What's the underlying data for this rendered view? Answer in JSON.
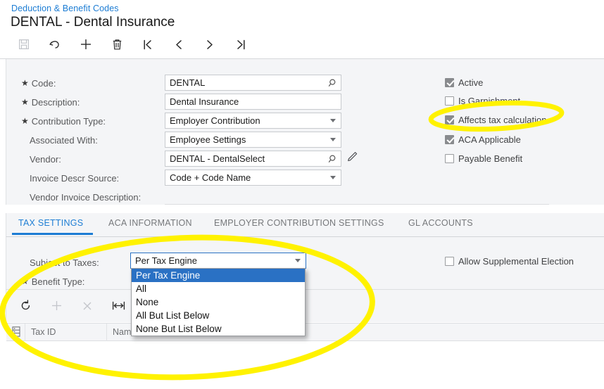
{
  "header": {
    "breadcrumb": "Deduction & Benefit Codes",
    "title": "DENTAL - Dental Insurance",
    "toolbar": [
      {
        "name": "save-button",
        "icon": "save-icon",
        "disabled": true
      },
      {
        "name": "undo-button",
        "icon": "undo-icon",
        "disabled": false
      },
      {
        "name": "add-button",
        "icon": "plus-icon",
        "disabled": false
      },
      {
        "name": "delete-button",
        "icon": "trash-icon",
        "disabled": false
      },
      {
        "name": "first-record-button",
        "icon": "first-icon",
        "disabled": false
      },
      {
        "name": "previous-record-button",
        "icon": "chevron-left-icon",
        "disabled": false
      },
      {
        "name": "next-record-button",
        "icon": "chevron-right-icon",
        "disabled": false
      },
      {
        "name": "last-record-button",
        "icon": "last-icon",
        "disabled": false
      }
    ]
  },
  "form": {
    "fields": [
      {
        "label": "Code:",
        "required": true,
        "value": "DENTAL",
        "control": "lookup"
      },
      {
        "label": "Description:",
        "required": true,
        "value": "Dental Insurance",
        "control": "text"
      },
      {
        "label": "Contribution Type:",
        "required": true,
        "value": "Employer Contribution",
        "control": "select"
      },
      {
        "label": "Associated With:",
        "required": false,
        "value": "Employee Settings",
        "control": "select"
      },
      {
        "label": "Vendor:",
        "required": false,
        "value": "DENTAL - DentalSelect",
        "control": "lookup-edit"
      },
      {
        "label": "Invoice Descr Source:",
        "required": false,
        "value": "Code + Code Name",
        "control": "select"
      },
      {
        "label": "Vendor Invoice Description:",
        "required": false,
        "value": "",
        "control": "none"
      }
    ],
    "checkboxes": [
      {
        "label": "Active",
        "checked": true
      },
      {
        "label": "Is Garnishment",
        "checked": false
      },
      {
        "label": "Affects tax calculation",
        "checked": true
      },
      {
        "label": "ACA Applicable",
        "checked": true
      },
      {
        "label": "Payable Benefit",
        "checked": false
      }
    ]
  },
  "tabs": [
    {
      "label": "TAX SETTINGS",
      "active": true
    },
    {
      "label": "ACA INFORMATION",
      "active": false
    },
    {
      "label": "EMPLOYER CONTRIBUTION SETTINGS",
      "active": false
    },
    {
      "label": "GL ACCOUNTS",
      "active": false
    }
  ],
  "tax_settings": {
    "subject_to_taxes_label": "Subject to Taxes:",
    "subject_to_taxes_value": "Per Tax Engine",
    "benefit_type_label": "Benefit Type:",
    "benefit_type_required": true,
    "allow_supplemental_election": {
      "label": "Allow Supplemental Election",
      "checked": false
    },
    "dropdown_options": [
      {
        "label": "Per Tax Engine",
        "selected": true
      },
      {
        "label": "All",
        "selected": false
      },
      {
        "label": "None",
        "selected": false
      },
      {
        "label": "All But List Below",
        "selected": false
      },
      {
        "label": "None But List Below",
        "selected": false
      }
    ],
    "grid_toolbar": [
      {
        "name": "refresh-button",
        "icon": "refresh-icon",
        "disabled": false
      },
      {
        "name": "add-row-button",
        "icon": "plus-icon",
        "disabled": true
      },
      {
        "name": "delete-row-button",
        "icon": "close-icon",
        "disabled": true
      },
      {
        "name": "fit-columns-button",
        "icon": "fit-width-icon",
        "disabled": false
      }
    ],
    "grid_columns": [
      "Tax ID",
      "Name"
    ],
    "grid_rows": []
  },
  "colors": {
    "accent": "#1d7dd4",
    "panel": "#f4f5f7",
    "highlight": "#fff200",
    "selected_row": "#2a71c4",
    "checkbox_checked": "#898b8e"
  },
  "annotations": [
    {
      "name": "affects-tax-calculation-highlight",
      "shape": "ellipse"
    },
    {
      "name": "subject-to-taxes-highlight",
      "shape": "ellipse"
    }
  ]
}
